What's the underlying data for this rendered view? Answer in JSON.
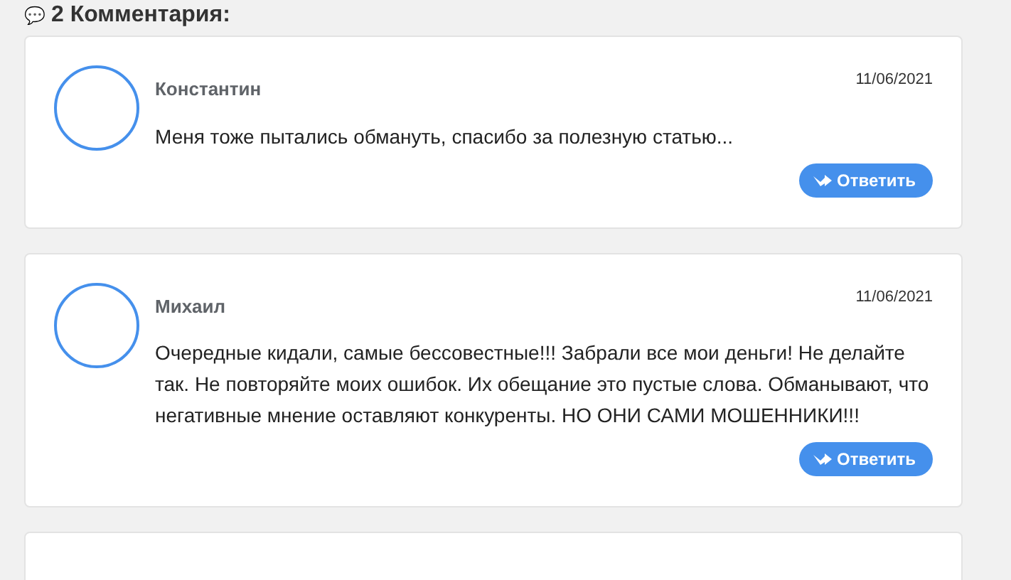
{
  "heading": {
    "icon": "💬",
    "text": "2 Комментария:"
  },
  "comments": [
    {
      "author": "Константин",
      "date": "11/06/2021",
      "text": "Меня тоже пытались обмануть, спасибо за полезную статью...",
      "reply": "Ответить"
    },
    {
      "author": "Михаил",
      "date": "11/06/2021",
      "text": "Очередные кидали, самые бессовестные!!! Забрали все мои деньги! Не делайте так. Не повторяйте моих ошибок. Их обещание это пустые слова. Обманывают, что негативные мнение оставляют конкуренты. НО ОНИ САМИ МОШЕННИКИ!!!",
      "reply": "Ответить"
    }
  ]
}
